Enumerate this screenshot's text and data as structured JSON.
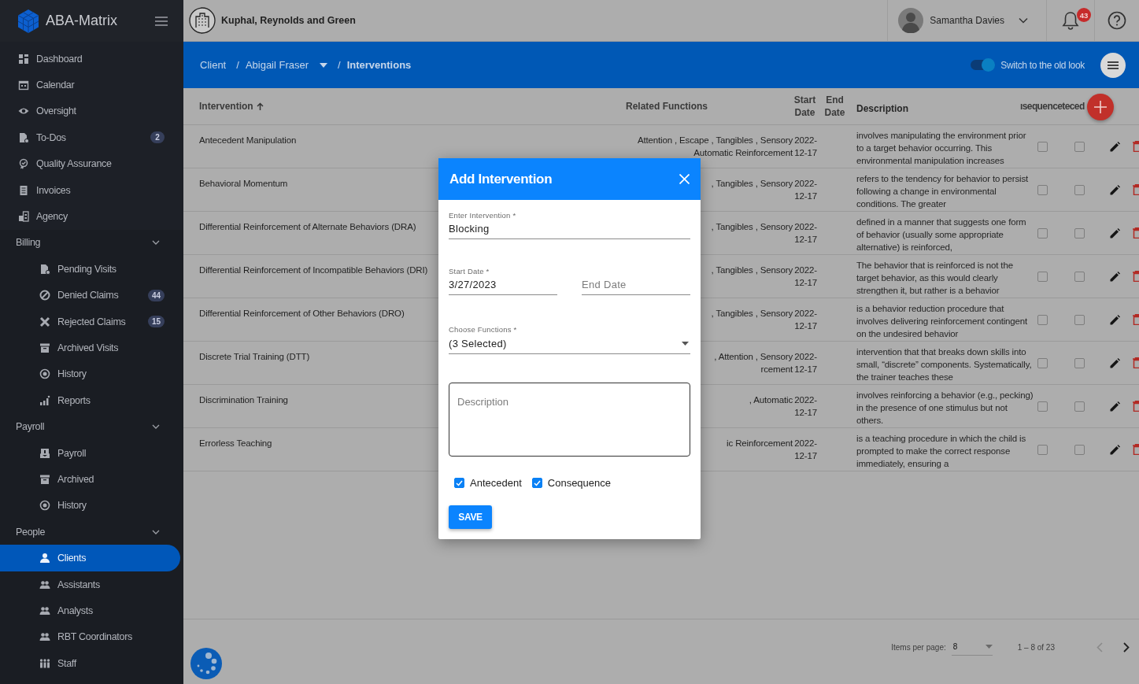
{
  "app": {
    "name": "ABA-Matrix"
  },
  "sidebar": {
    "items": [
      {
        "label": "Dashboard",
        "selected": false
      },
      {
        "label": "Calendar",
        "selected": false
      },
      {
        "label": "Oversight",
        "selected": false
      },
      {
        "label": "To-Dos",
        "badge": "2",
        "selected": false
      },
      {
        "label": "Quality Assurance",
        "selected": false
      },
      {
        "label": "Invoices",
        "selected": false
      },
      {
        "label": "Agency",
        "selected": false
      }
    ],
    "sections": [
      {
        "label": "Billing",
        "expanded": true,
        "items": [
          {
            "label": "Pending Visits",
            "selected": false
          },
          {
            "label": "Denied Claims",
            "badge": "44",
            "selected": false
          },
          {
            "label": "Rejected Claims",
            "badge": "15",
            "selected": false
          },
          {
            "label": "Archived Visits",
            "selected": false
          },
          {
            "label": "History",
            "selected": false
          },
          {
            "label": "Reports",
            "selected": false
          }
        ]
      },
      {
        "label": "Payroll",
        "expanded": true,
        "items": [
          {
            "label": "Payroll",
            "selected": false
          },
          {
            "label": "Archived",
            "selected": false
          },
          {
            "label": "History",
            "selected": false
          }
        ]
      },
      {
        "label": "People",
        "expanded": true,
        "items": [
          {
            "label": "Clients",
            "selected": true
          },
          {
            "label": "Assistants",
            "selected": false
          },
          {
            "label": "Analysts",
            "selected": false
          },
          {
            "label": "RBT Coordinators",
            "selected": false
          },
          {
            "label": "Staff",
            "selected": false
          }
        ]
      }
    ]
  },
  "header": {
    "company": "Kuphal, Reynolds and Green",
    "user": "Samantha Davies",
    "notification_count": "43"
  },
  "breadcrumb": [
    {
      "label": "Client",
      "kind": "link"
    },
    {
      "label": "Abigail Fraser",
      "kind": "dropdown",
      "prefix": "/"
    },
    {
      "label": "Interventions",
      "kind": "current",
      "prefix": "/"
    }
  ],
  "toggle": {
    "label": "Switch to the old look",
    "on": true
  },
  "table": {
    "columns": [
      {
        "label": "Intervention",
        "sorted": true
      },
      {
        "label": "Related Functions",
        "sorted": false
      },
      {
        "label": "Start Date",
        "sorted": false
      },
      {
        "label": "End Date",
        "sorted": false
      },
      {
        "label": "Description",
        "sorted": false
      },
      {
        "label": "ısequence",
        "sorted": false
      },
      {
        "label": "teced",
        "sorted": false
      }
    ],
    "rows": [
      {
        "intervention": "Antecedent Manipulation",
        "related_functions": [
          "Attention , Escape , Tangibles , Sensory",
          "Automatic Reinforcement"
        ],
        "start_date": "2022-12-17",
        "description": "involves manipulating the environment prior to a target behavior occurring. This environmental manipulation increases",
        "checks": [
          {
            "checked": false
          },
          {
            "checked": false
          }
        ]
      },
      {
        "intervention": "Behavioral Momentum",
        "related_functions": [
          ", Tangibles , Sensory"
        ],
        "start_date": "2022-12-17",
        "description": "refers to the tendency for behavior to persist following a change in environmental conditions. The greater",
        "checks": [
          {
            "checked": false
          },
          {
            "checked": false
          }
        ]
      },
      {
        "intervention": "Differential Reinforcement of Alternate Behaviors (DRA)",
        "related_functions": [
          ", Tangibles , Sensory"
        ],
        "start_date": "2022-12-17",
        "description": "defined in a manner that suggests one form of behavior (usually some appropriate alternative) is reinforced,",
        "checks": [
          {
            "checked": false
          },
          {
            "checked": false
          }
        ]
      },
      {
        "intervention": "Differential Reinforcement of Incompatible Behaviors (DRI)",
        "related_functions": [
          ", Tangibles , Sensory"
        ],
        "start_date": "2022-12-17",
        "description": "The behavior that is reinforced is not the target behavior, as this would clearly strengthen it, but rather is a behavior",
        "checks": [
          {
            "checked": false
          },
          {
            "checked": false
          }
        ]
      },
      {
        "intervention": "Differential Reinforcement of Other Behaviors (DRO)",
        "related_functions": [
          ", Tangibles , Sensory"
        ],
        "start_date": "2022-12-17",
        "description": "is a behavior reduction procedure that involves delivering reinforcement contingent on the undesired behavior",
        "checks": [
          {
            "checked": false
          },
          {
            "checked": false
          }
        ]
      },
      {
        "intervention": "Discrete Trial Training (DTT)",
        "related_functions": [
          ", Attention , Sensory",
          "rcement"
        ],
        "start_date": "2022-12-17",
        "description": "intervention that that breaks down skills into small, “discrete” components. Systematically, the trainer teaches these",
        "checks": [
          {
            "checked": false
          },
          {
            "checked": false
          }
        ]
      },
      {
        "intervention": "Discrimination Training",
        "related_functions": [
          ", Automatic"
        ],
        "start_date": "2022-12-17",
        "description": "involves reinforcing a behavior (e.g., pecking) in the presence of one stimulus but not others.",
        "checks": [
          {
            "checked": false
          },
          {
            "checked": false
          }
        ]
      },
      {
        "intervention": "Errorless Teaching",
        "related_functions": [
          "ic Reinforcement"
        ],
        "start_date": "2022-12-17",
        "description": "is a teaching procedure in which the child is prompted to make the correct response immediately, ensuring a",
        "checks": [
          {
            "checked": false
          },
          {
            "checked": false
          }
        ]
      }
    ]
  },
  "paginator": {
    "label": "Items per page:",
    "page_size": "8",
    "range": "1 – 8 of 23"
  },
  "dialog": {
    "title": "Add Intervention",
    "intervention": {
      "label": "Enter Intervention *",
      "value": "Blocking"
    },
    "start_date": {
      "label": "Start Date *",
      "value": "3/27/2023"
    },
    "end_date": {
      "placeholder": "End Date"
    },
    "functions": {
      "label": "Choose Functions *",
      "value": "(3 Selected)"
    },
    "description": {
      "placeholder": "Description"
    },
    "checkboxes": [
      {
        "label": "Antecedent",
        "checked": true
      },
      {
        "label": "Consequence",
        "checked": true
      }
    ],
    "save": "SAVE"
  }
}
